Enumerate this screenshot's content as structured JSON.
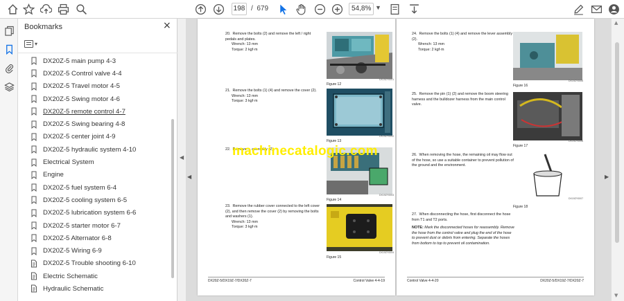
{
  "toolbar": {
    "page_current": "198",
    "page_separator": "/",
    "page_total": "679",
    "zoom": "54,8%"
  },
  "bookmarks_panel": {
    "title": "Bookmarks",
    "close_glyph": "×",
    "items": [
      {
        "label": "DX20Z-5 main pump 4-3",
        "icon": "bookmark-icon"
      },
      {
        "label": "DX20Z-5 Control valve 4-4",
        "icon": "bookmark-icon"
      },
      {
        "label": "DX20Z-5 Travel motor 4-5",
        "icon": "bookmark-icon"
      },
      {
        "label": "DX20Z-5 Swing motor 4-6",
        "icon": "bookmark-icon"
      },
      {
        "label": "DX20Z-5 remote control 4-7",
        "icon": "bookmark-icon"
      },
      {
        "label": "DX20Z-5 Swing bearing 4-8",
        "icon": "bookmark-icon"
      },
      {
        "label": "DX20Z-5 center joint 4-9",
        "icon": "bookmark-icon"
      },
      {
        "label": "DX20Z-5 hydraulic system 4-10",
        "icon": "bookmark-icon"
      },
      {
        "label": "Electrical System",
        "icon": "bookmark-icon"
      },
      {
        "label": "Engine",
        "icon": "bookmark-icon"
      },
      {
        "label": "DX20Z-5  fuel system 6-4",
        "icon": "bookmark-icon"
      },
      {
        "label": "DX20Z-5  cooling system 6-5",
        "icon": "bookmark-icon"
      },
      {
        "label": "DX20Z-5  lubrication system 6-6",
        "icon": "bookmark-icon"
      },
      {
        "label": "DX20Z-5  starter motor 6-7",
        "icon": "bookmark-icon"
      },
      {
        "label": "DX20Z-5  Alternator 6-8",
        "icon": "bookmark-icon"
      },
      {
        "label": "DX20Z-5  Wiring 6-9",
        "icon": "bookmark-icon"
      },
      {
        "label": "DX20Z-5  Trouble shooting 6-10",
        "icon": "bookmark-page-icon"
      },
      {
        "label": "Electric Schematic",
        "icon": "bookmark-page-icon"
      },
      {
        "label": "Hydraulic Schematic",
        "icon": "bookmark-page-icon"
      }
    ]
  },
  "page_left": {
    "steps": [
      {
        "num": "20.",
        "text": "Remove the bolts (2) and remove the left / right pedals and plates.",
        "wrench": "Wrench: 13 mm",
        "torque": "Torque:    2 kgf·m"
      },
      {
        "num": "21.",
        "text": "Remove the bolts (1) (4) and remove the cover (2).",
        "wrench": "Wrench: 13 mm",
        "torque": "Torque:    3 kgf·m"
      },
      {
        "num": "22.",
        "text": "Remove ... assembly (2)."
      },
      {
        "num": "23.",
        "text": "Remove the rubber cover connected to the left cover (2), and then remove the cover (2) by removing the bolts and washers (1).",
        "wrench": "Wrench: 13 mm",
        "torque": "Torque:    3 kgf·m"
      }
    ],
    "figures": [
      "Figure 12",
      "Figure 13",
      "Figure 14",
      "Figure 15"
    ],
    "fig_codes": [
      "DX19ZY0001",
      "DX19ZY0002",
      "DX19ZY0003",
      "DX19ZY0004"
    ],
    "footer_left": "DX20Z-5/DX19Z-7/DX20Z-7",
    "footer_right": "Control Valve  4-4-19"
  },
  "page_right": {
    "steps": [
      {
        "num": "24.",
        "text": "Remove the bolts (1) (4) and remove the lever assembly (2).",
        "wrench": "Wrench: 13 mm",
        "torque": "Torque:    2 kgf·m"
      },
      {
        "num": "25.",
        "text": "Remove the pin (1) (2) and remove the boom steering harness and the bulldozer harness from the main control valve."
      },
      {
        "num": "26.",
        "text": "When removing the hose, the remaining oil may flow out of the hose, so use a suitable container to prevent pollution of the ground and the environment."
      },
      {
        "num": "27.",
        "text": "When disconnecting the hose, first disconnect the hose from T1 and T2 ports."
      }
    ],
    "note_label": "NOTE:",
    "note_text": "Mark the disconnected hoses for reassembly. Remove the hose from the control valve and plug the end of the hose to prevent dust or debris from entering. Separate the hoses from bottom to top to prevent oil contamination.",
    "figures": [
      "Figure 16",
      "Figure 17",
      "Figure 18"
    ],
    "fig_codes": [
      "DX19ZY0005",
      "DX19ZY0006",
      "DX19ZY0007"
    ],
    "footer_left": "Control Valve  4-4-20",
    "footer_right": "DX20Z-5/DX19Z-7/DX20Z-7"
  },
  "watermark": "machinecatalogic.com",
  "colors": {
    "watermark": "#ffee00",
    "toolbar_bg": "#ffffff",
    "panel_bg": "#ffffff",
    "doc_bg": "#dcdcdc"
  }
}
